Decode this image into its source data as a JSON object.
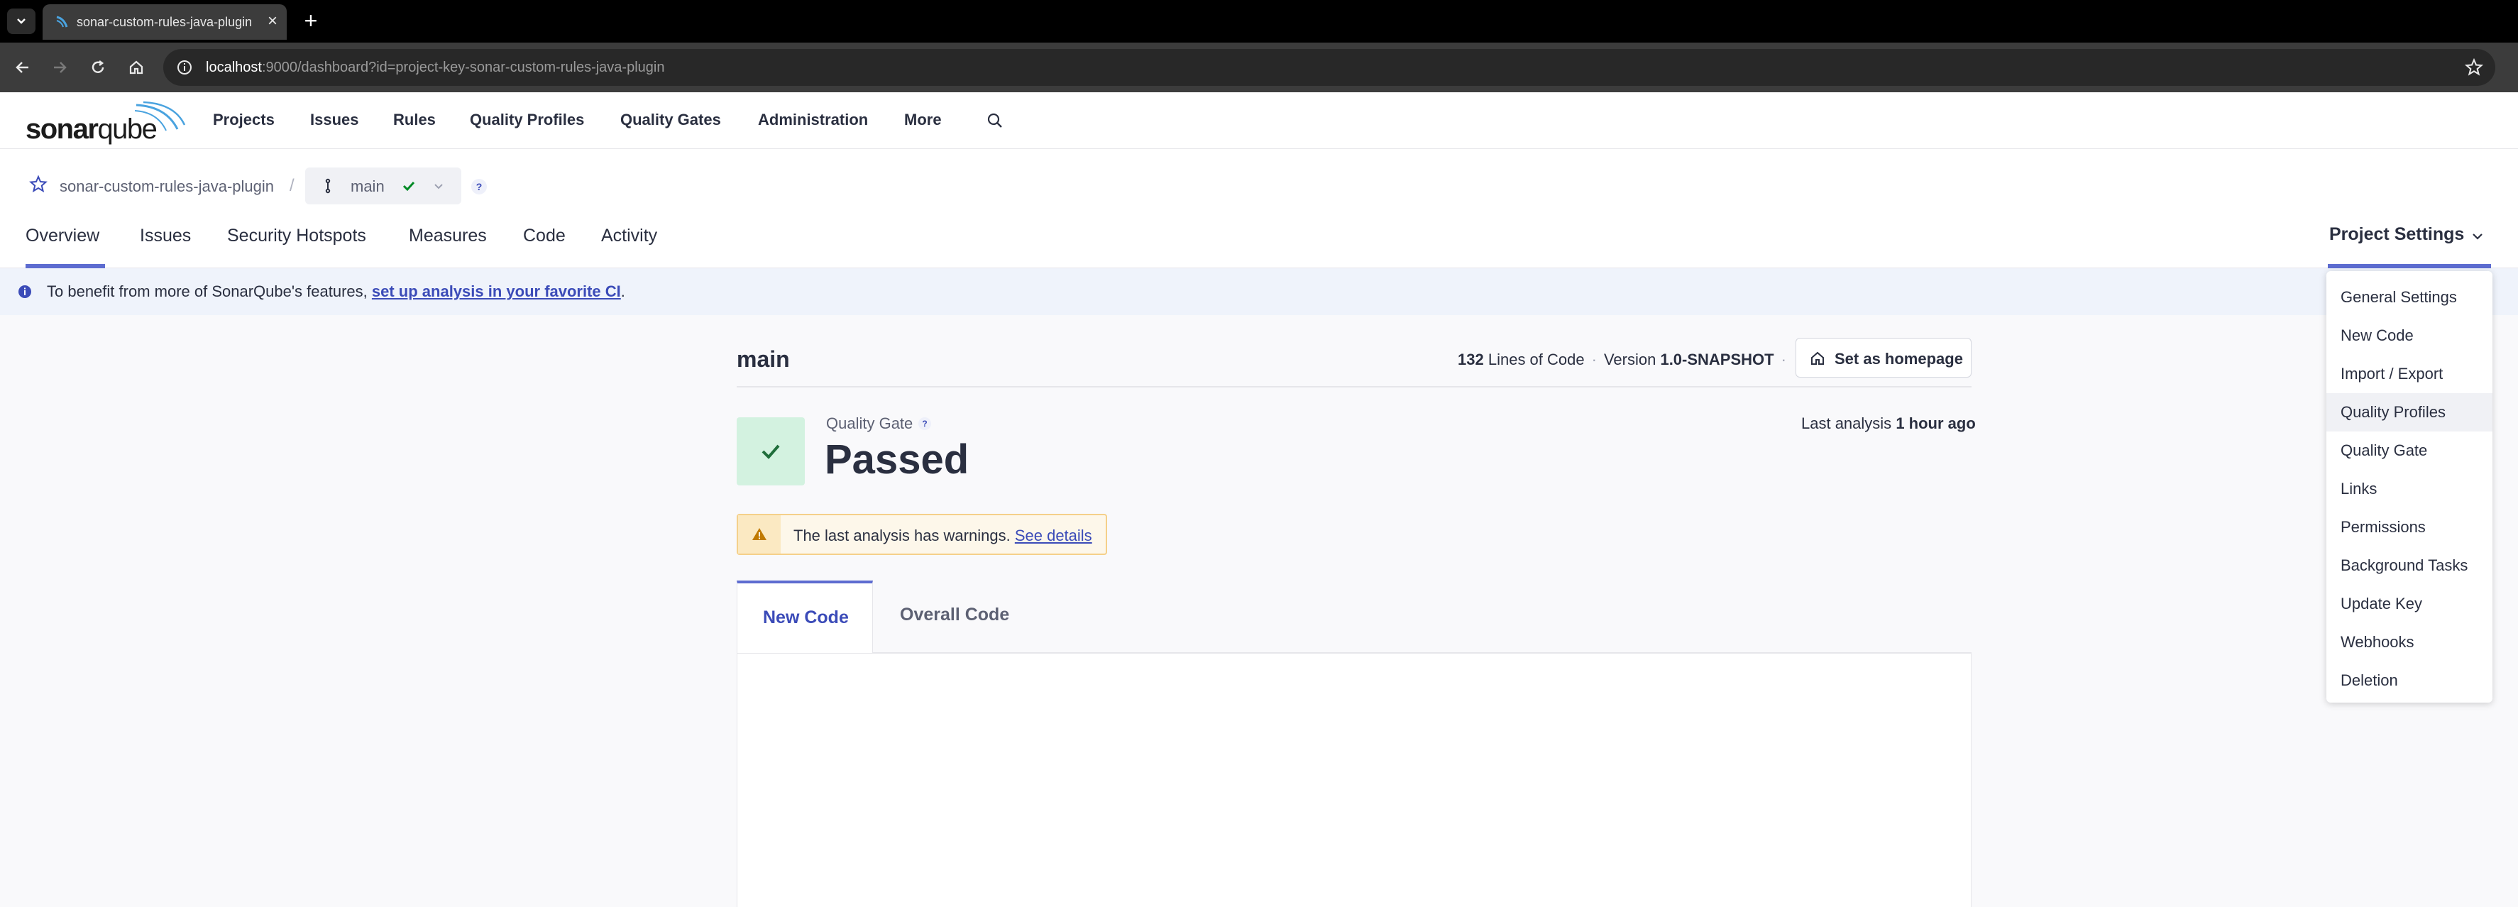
{
  "browser": {
    "tab_title": "sonar-custom-rules-java-plugin",
    "url_host": "localhost",
    "url_rest": ":9000/dashboard?id=project-key-sonar-custom-rules-java-plugin"
  },
  "header": {
    "logo_bold": "sonar",
    "logo_light": "qube",
    "nav": [
      "Projects",
      "Issues",
      "Rules",
      "Quality Profiles",
      "Quality Gates",
      "Administration",
      "More"
    ]
  },
  "project": {
    "name": "sonar-custom-rules-java-plugin",
    "separator": "/",
    "branch": "main",
    "help": "?",
    "tabs": [
      "Overview",
      "Issues",
      "Security Hotspots",
      "Measures",
      "Code",
      "Activity"
    ],
    "settings_label": "Project Settings"
  },
  "banner": {
    "text": "To benefit from more of SonarQube's features,",
    "link": "set up analysis in your favorite CI",
    "suffix": "."
  },
  "main": {
    "title": "main",
    "lines_count": "132",
    "lines_label": "Lines of Code",
    "version_label": "Version",
    "version_value": "1.0-SNAPSHOT",
    "homepage_button": "Set as homepage",
    "quality_gate_label": "Quality Gate",
    "quality_gate_status": "Passed",
    "last_analysis_label": "Last analysis",
    "last_analysis_value": "1 hour ago",
    "warning_text": "The last analysis has warnings.",
    "warning_link": "See details",
    "code_tabs": [
      "New Code",
      "Overall Code"
    ]
  },
  "settings_menu": {
    "items": [
      "General Settings",
      "New Code",
      "Import / Export",
      "Quality Profiles",
      "Quality Gate",
      "Links",
      "Permissions",
      "Background Tasks",
      "Update Key",
      "Webhooks",
      "Deletion"
    ],
    "highlighted": "Quality Profiles"
  },
  "colors": {
    "accent": "#5d6cd0",
    "link": "#3b4bb8",
    "passed_bg": "#d3f2e0",
    "passed_check": "#008a25",
    "warning_border": "#f5d08a"
  }
}
